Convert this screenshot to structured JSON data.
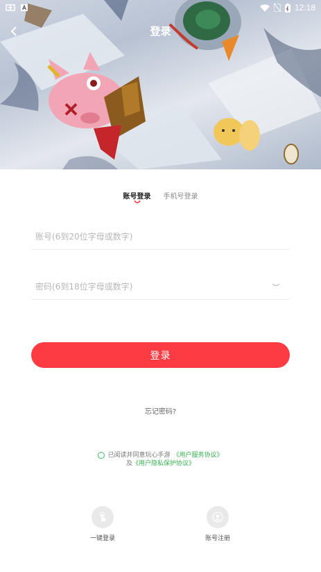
{
  "status_bar": {
    "time": "12:18"
  },
  "header": {
    "title": "登录"
  },
  "tabs": [
    {
      "label": "账号登录",
      "active": true
    },
    {
      "label": "手机号登录",
      "active": false
    }
  ],
  "form": {
    "account_placeholder": "账号(6到20位字母或数字)",
    "password_placeholder": "密码(6到18位字母或数字)",
    "login_label": "登录",
    "forgot_label": "忘记密码?"
  },
  "agreement": {
    "prefix": "已阅读并同意玩心手游",
    "service_link": "《用户服务协议》",
    "join": "及",
    "privacy_link": "《用户隐私保护协议》"
  },
  "bottom_options": [
    {
      "label": "一键登录",
      "icon": "one-tap-icon"
    },
    {
      "label": "账号注册",
      "icon": "user-register-icon"
    }
  ],
  "colors": {
    "accent": "#fd3b42",
    "link": "#36b04f"
  }
}
